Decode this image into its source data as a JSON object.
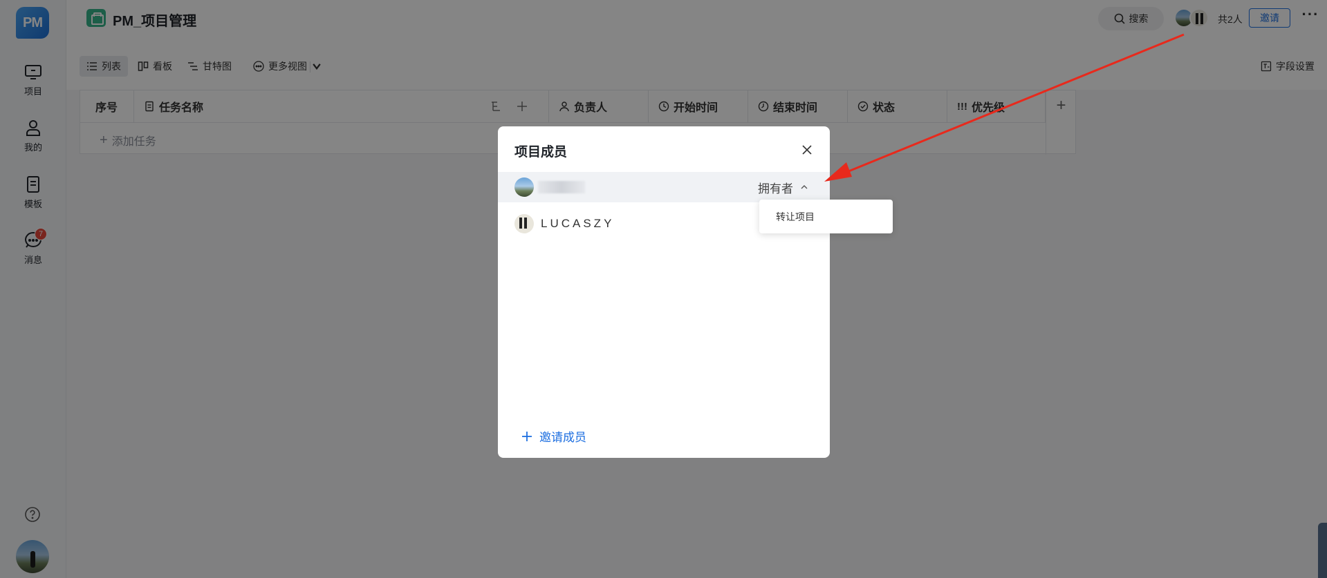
{
  "sidebar": {
    "logo": "PM",
    "items": [
      {
        "label": "项目",
        "icon": "monitor-icon"
      },
      {
        "label": "我的",
        "icon": "user-icon"
      },
      {
        "label": "模板",
        "icon": "document-icon"
      },
      {
        "label": "消息",
        "icon": "chat-icon",
        "badge": "7"
      }
    ]
  },
  "header": {
    "project_title": "PM_项目管理",
    "search_label": "搜索",
    "member_count": "共2人",
    "invite_label": "邀请",
    "more_label": "···"
  },
  "toolbar": {
    "views": [
      "列表",
      "看板",
      "甘特图",
      "更多视图"
    ],
    "field_settings": "字段设置"
  },
  "table": {
    "columns": [
      "序号",
      "任务名称",
      "负责人",
      "开始时间",
      "结束时间",
      "状态",
      "优先级"
    ],
    "add_task": "添加任务"
  },
  "modal": {
    "title": "项目成员",
    "members": [
      {
        "name": "",
        "role": "拥有者"
      },
      {
        "name": "LUCASZY",
        "role": ""
      }
    ],
    "dropdown_option": "转让项目",
    "invite_member": "邀请成员"
  },
  "colors": {
    "accent": "#1e6fe0",
    "arrow": "#e8291c",
    "badge": "#e8473b"
  }
}
